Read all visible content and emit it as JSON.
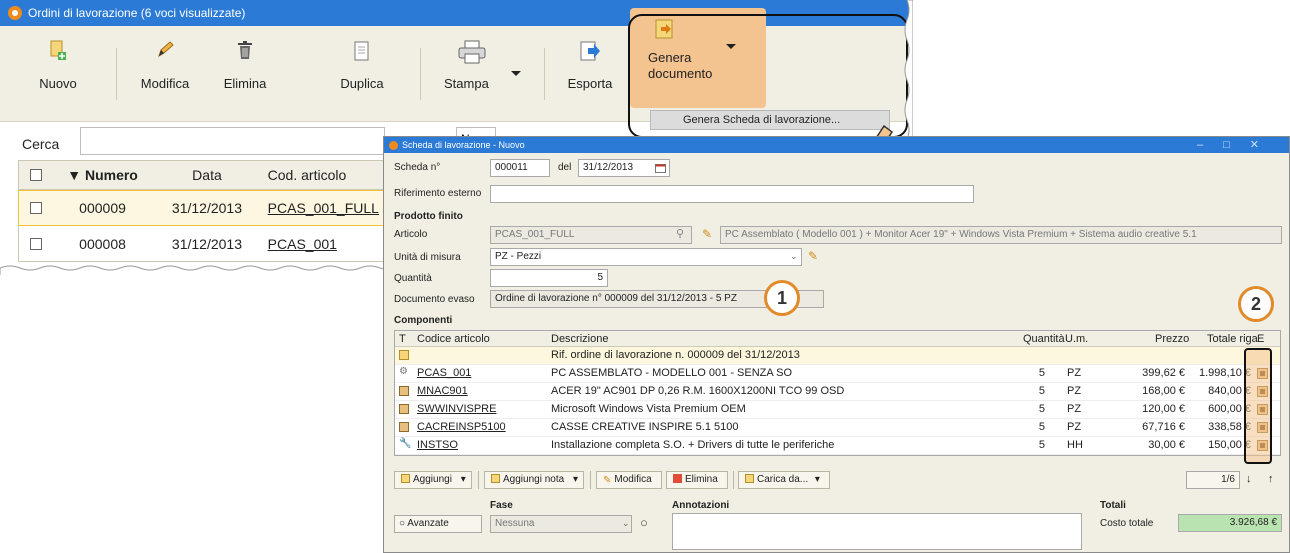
{
  "back_window": {
    "title": "Ordini di lavorazione (6 voci visualizzate)",
    "ribbon": {
      "nuovo": "Nuovo",
      "modifica": "Modifica",
      "elimina": "Elimina",
      "duplica": "Duplica",
      "stampa": "Stampa",
      "esporta": "Esporta",
      "genera_line1": "Genera",
      "genera_line2": "documento",
      "genera_menu_item": "Genera Scheda di lavorazione..."
    },
    "search_label": "Cerca",
    "search_value": "",
    "filter_field_value": "N",
    "grid": {
      "headers": {
        "numero": "Numero",
        "data": "Data",
        "cod_articolo": "Cod. articolo"
      },
      "rows": [
        {
          "numero": "000009",
          "data": "31/12/2013",
          "cod_articolo": "PCAS_001_FULL"
        },
        {
          "numero": "000008",
          "data": "31/12/2013",
          "cod_articolo": "PCAS_001"
        }
      ]
    }
  },
  "front_window": {
    "title": "Scheda di lavorazione - Nuovo",
    "labels": {
      "scheda": "Scheda n°",
      "del": "del",
      "riferimento": "Riferimento esterno",
      "prodotto_finito": "Prodotto finito",
      "articolo": "Articolo",
      "unita": "Unità di misura",
      "quantita": "Quantità",
      "documento_evaso": "Documento evaso",
      "componenti": "Componenti",
      "fase": "Fase",
      "annotazioni": "Annotazioni",
      "totali": "Totali",
      "costo_totale": "Costo totale"
    },
    "values": {
      "scheda_n": "000011",
      "data": "31/12/2013",
      "riferimento": "",
      "articolo_code": "PCAS_001_FULL",
      "articolo_desc": "PC Assemblato ( Modello 001 ) + Monitor Acer 19\" + Windows Vista Premium + Sistema audio creative 5.1",
      "unita": "PZ - Pezzi",
      "quantita": "5",
      "documento_evaso": "Ordine di lavorazione n° 000009 del 31/12/2013 - 5 PZ",
      "fase": "Nessuna",
      "avanzate": "Avanzate",
      "costo_totale": "3.926,68 €",
      "pager": "1/6"
    },
    "grid": {
      "headers": {
        "t": "T",
        "codice": "Codice articolo",
        "descrizione": "Descrizione",
        "quantita": "Quantità",
        "um": "U.m.",
        "prezzo": "Prezzo",
        "totale": "Totale riga",
        "e": "E"
      },
      "rows": [
        {
          "type": "note",
          "codice": "",
          "descrizione": "Rif. ordine di lavorazione n. 000009 del 31/12/2013",
          "quantita": "",
          "um": "",
          "prezzo": "",
          "totale": ""
        },
        {
          "type": "assembly",
          "codice": "PCAS_001",
          "descrizione": "PC ASSEMBLATO - MODELLO 001 - SENZA SO",
          "quantita": "5",
          "um": "PZ",
          "prezzo": "399,62 €",
          "totale": "1.998,10 €"
        },
        {
          "type": "item",
          "codice": "MNAC901",
          "descrizione": "ACER 19\" AC901 DP 0,26 R.M. 1600X1200NI TCO 99 OSD",
          "quantita": "5",
          "um": "PZ",
          "prezzo": "168,00 €",
          "totale": "840,00 €"
        },
        {
          "type": "item",
          "codice": "SWWINVISPRE",
          "descrizione": "Microsoft Windows Vista Premium OEM",
          "quantita": "5",
          "um": "PZ",
          "prezzo": "120,00 €",
          "totale": "600,00 €"
        },
        {
          "type": "item",
          "codice": "CACREINSP5100",
          "descrizione": "CASSE CREATIVE INSPIRE 5.1 5100",
          "quantita": "5",
          "um": "PZ",
          "prezzo": "67,716 €",
          "totale": "338,58 €"
        },
        {
          "type": "service",
          "codice": "INSTSO",
          "descrizione": "Installazione completa S.O. + Drivers di tutte le periferiche",
          "quantita": "5",
          "um": "HH",
          "prezzo": "30,00 €",
          "totale": "150,00 €"
        }
      ]
    },
    "toolbar": {
      "aggiungi": "Aggiungi",
      "aggiungi_nota": "Aggiungi nota",
      "modifica": "Modifica",
      "elimina": "Elimina",
      "carica_da": "Carica da..."
    }
  },
  "callouts": {
    "one": "1",
    "two": "2"
  },
  "colors": {
    "titlebar": "#2b7bd6",
    "highlight": "#f4c490",
    "badge_border": "#e08a2a",
    "total_bg": "#b9e3b0"
  }
}
